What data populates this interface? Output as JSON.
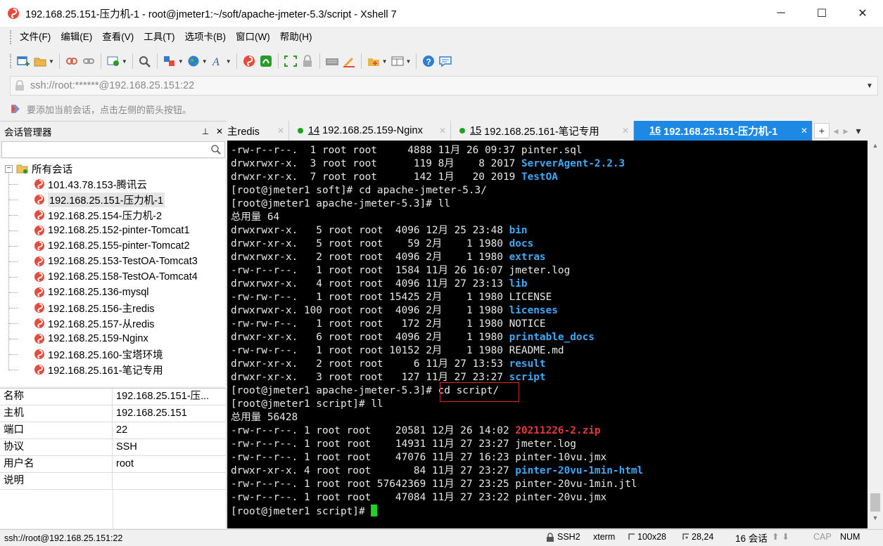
{
  "window": {
    "title": "192.168.25.151-压力机-1 - root@jmeter1:~/soft/apache-jmeter-5.3/script - Xshell 7",
    "minimize": "─",
    "maximize": "☐",
    "close": "✕"
  },
  "menu": [
    "文件(F)",
    "编辑(E)",
    "查看(V)",
    "工具(T)",
    "选项卡(B)",
    "窗口(W)",
    "帮助(H)"
  ],
  "address": {
    "value": "ssh://root:******@192.168.25.151:22"
  },
  "hint": "要添加当前会话，点击左侧的箭头按钮。",
  "session_manager": {
    "title": "会话管理器",
    "pin": "ᵖ",
    "close": "✕",
    "root": "所有会话",
    "expander": "−",
    "items": [
      "101.43.78.153-腾讯云",
      "192.168.25.151-压力机-1",
      "192.168.25.154-压力机-2",
      "192.168.25.152-pinter-Tomcat1",
      "192.168.25.155-pinter-Tomcat2",
      "192.168.25.153-TestOA-Tomcat3",
      "192.168.25.158-TestOA-Tomcat4",
      "192.168.25.136-mysql",
      "192.168.25.156-主redis",
      "192.168.25.157-从redis",
      "192.168.25.159-Nginx",
      "192.168.25.160-宝塔环境",
      "192.168.25.161-笔记专用"
    ],
    "selected_index": 1
  },
  "properties": [
    {
      "key": "名称",
      "value": "192.168.25.151-压..."
    },
    {
      "key": "主机",
      "value": "192.168.25.151"
    },
    {
      "key": "端口",
      "value": "22"
    },
    {
      "key": "协议",
      "value": "SSH"
    },
    {
      "key": "用户名",
      "value": "root"
    },
    {
      "key": "说明",
      "value": ""
    }
  ],
  "tabs": [
    {
      "num": "",
      "label": "主redis",
      "active": false,
      "dot": false
    },
    {
      "num": "14",
      "label": "192.168.25.159-Nginx",
      "active": false,
      "dot": true
    },
    {
      "num": "15",
      "label": "192.168.25.161-笔记专用",
      "active": false,
      "dot": true
    },
    {
      "num": "16",
      "label": "192.168.25.151-压力机-1",
      "active": true,
      "dot": false
    }
  ],
  "tab_controls": {
    "add": "+",
    "prev": "◂",
    "next": "▸",
    "menu": "▾"
  },
  "terminal": {
    "lines": [
      [
        {
          "t": "-rw-r--r--.  1 root root     4888 11月 26 09:37 pinter.sql"
        }
      ],
      [
        {
          "t": "drwxrwxr-x.  3 root root      119 8月    8 2017 "
        },
        {
          "t": "ServerAgent-2.2.3",
          "c": "blue"
        }
      ],
      [
        {
          "t": "drwxr-xr-x.  7 root root      142 1月   20 2019 "
        },
        {
          "t": "TestOA",
          "c": "blue"
        }
      ],
      [
        {
          "t": "[root@jmeter1 soft]# cd apache-jmeter-5.3/"
        }
      ],
      [
        {
          "t": "[root@jmeter1 apache-jmeter-5.3]# ll"
        }
      ],
      [
        {
          "t": "总用量 64"
        }
      ],
      [
        {
          "t": "drwxrwxr-x.   5 root root  4096 12月 25 23:48 "
        },
        {
          "t": "bin",
          "c": "blue"
        }
      ],
      [
        {
          "t": "drwxr-xr-x.   5 root root    59 2月    1 1980 "
        },
        {
          "t": "docs",
          "c": "blue"
        }
      ],
      [
        {
          "t": "drwxrwxr-x.   2 root root  4096 2月    1 1980 "
        },
        {
          "t": "extras",
          "c": "blue"
        }
      ],
      [
        {
          "t": "-rw-r--r--.   1 root root  1584 11月 26 16:07 jmeter.log"
        }
      ],
      [
        {
          "t": "drwxrwxr-x.   4 root root  4096 11月 27 23:13 "
        },
        {
          "t": "lib",
          "c": "blue"
        }
      ],
      [
        {
          "t": "-rw-rw-r--.   1 root root 15425 2月    1 1980 LICENSE"
        }
      ],
      [
        {
          "t": "drwxrwxr-x. 100 root root  4096 2月    1 1980 "
        },
        {
          "t": "licenses",
          "c": "blue"
        }
      ],
      [
        {
          "t": "-rw-rw-r--.   1 root root   172 2月    1 1980 NOTICE"
        }
      ],
      [
        {
          "t": "drwxr-xr-x.   6 root root  4096 2月    1 1980 "
        },
        {
          "t": "printable_docs",
          "c": "blue"
        }
      ],
      [
        {
          "t": "-rw-rw-r--.   1 root root 10152 2月    1 1980 README.md"
        }
      ],
      [
        {
          "t": "drwxr-xr-x.   2 root root     6 11月 27 13:53 "
        },
        {
          "t": "result",
          "c": "blue"
        }
      ],
      [
        {
          "t": "drwxr-xr-x.   3 root root   127 11月 27 23:27 "
        },
        {
          "t": "script",
          "c": "blue"
        }
      ],
      [
        {
          "t": "[root@jmeter1 apache-jmeter-5.3]# cd script/"
        }
      ],
      [
        {
          "t": "[root@jmeter1 script]# ll"
        }
      ],
      [
        {
          "t": "总用量 56428"
        }
      ],
      [
        {
          "t": "-rw-r--r--. 1 root root    20581 12月 26 14:02 "
        },
        {
          "t": "20211226-2.zip",
          "c": "red"
        }
      ],
      [
        {
          "t": "-rw-r--r--. 1 root root    14931 11月 27 23:27 jmeter.log"
        }
      ],
      [
        {
          "t": "-rw-r--r--. 1 root root    47076 11月 27 16:23 pinter-10vu.jmx"
        }
      ],
      [
        {
          "t": "drwxr-xr-x. 4 root root       84 11月 27 23:27 "
        },
        {
          "t": "pinter-20vu-1min-html",
          "c": "blue"
        }
      ],
      [
        {
          "t": "-rw-r--r--. 1 root root 57642369 11月 27 23:25 pinter-20vu-1min.jtl"
        }
      ],
      [
        {
          "t": "-rw-r--r--. 1 root root    47084 11月 27 23:22 pinter-20vu.jmx"
        }
      ],
      [
        {
          "t": "[root@jmeter1 script]# "
        },
        {
          "t": "",
          "c": "cursor"
        }
      ]
    ]
  },
  "status": {
    "connection": "ssh://root@192.168.25.151:22",
    "protocol": "SSH2",
    "term": "xterm",
    "size": "100x28",
    "pos": "28,24",
    "sessions": "16 会话",
    "cap": "CAP",
    "num": "NUM"
  },
  "colors": {
    "active_tab": "#1e88e5",
    "dir_blue": "#3fa9f5",
    "archive_red": "#e63a3a",
    "cursor_green": "#21d321",
    "connected_dot": "#1aa51a"
  }
}
